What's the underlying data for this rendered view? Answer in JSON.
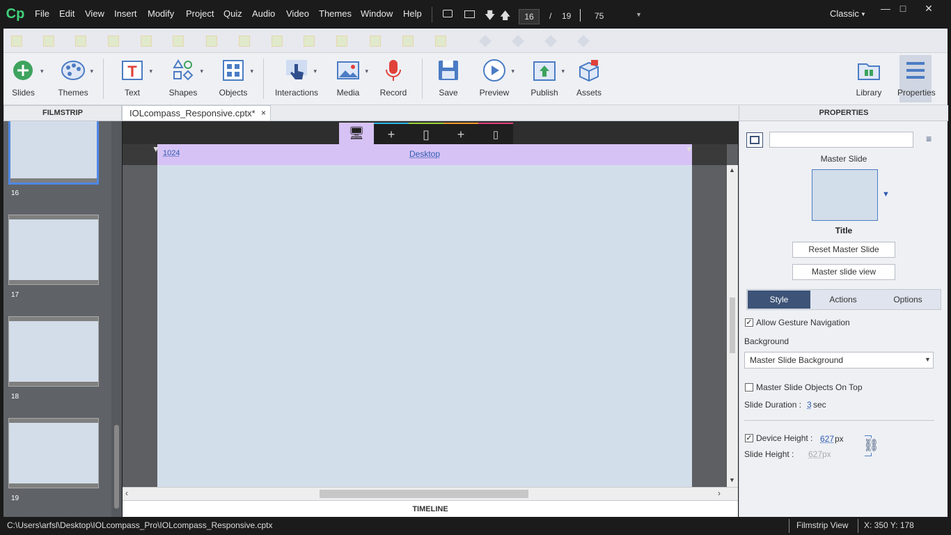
{
  "app": {
    "logo": "Cp",
    "mode": "Classic",
    "zoom": "75"
  },
  "menu": [
    "File",
    "Edit",
    "View",
    "Insert",
    "Modify",
    "Project",
    "Quiz",
    "Audio",
    "Video",
    "Themes",
    "Window",
    "Help"
  ],
  "nav": {
    "current_slide": "16",
    "separator": "/",
    "total_slides": "19"
  },
  "window_controls": {
    "minimize": "—",
    "maximize": "□",
    "close": "✕"
  },
  "toolbar": {
    "slides": "Slides",
    "themes": "Themes",
    "text": "Text",
    "shapes": "Shapes",
    "objects": "Objects",
    "interactions": "Interactions",
    "media": "Media",
    "record": "Record",
    "save": "Save",
    "preview": "Preview",
    "publish": "Publish",
    "assets": "Assets",
    "library": "Library",
    "properties": "Properties"
  },
  "filmstrip": {
    "title": "FILMSTRIP",
    "slides": [
      "16",
      "17",
      "18",
      "19"
    ]
  },
  "document": {
    "tab_label": "IOLcompass_Responsive.cptx*",
    "close": "×"
  },
  "canvas": {
    "ruler_width": "1024",
    "breakpoint": "Desktop",
    "timeline": "TIMELINE"
  },
  "properties": {
    "title": "PROPERTIES",
    "name_value": "",
    "master_slide_label": "Master Slide",
    "master_name": "Title",
    "reset_button": "Reset Master Slide",
    "master_view_button": "Master slide view",
    "tabs": [
      "Style",
      "Actions",
      "Options"
    ],
    "allow_gesture": "Allow Gesture Navigation",
    "background_label": "Background",
    "background_value": "Master Slide Background",
    "master_on_top": "Master Slide Objects On Top",
    "duration_label": "Slide Duration :",
    "duration_value": "3",
    "duration_unit": "sec",
    "device_height_label": "Device Height :",
    "device_height_value": "627",
    "slide_height_label": "Slide Height :",
    "slide_height_value": "627",
    "px": "px"
  },
  "status": {
    "path": "C:\\Users\\arfsl\\Desktop\\IOLcompass_Pro\\IOLcompass_Responsive.cptx",
    "view": "Filmstrip View",
    "coords": "X: 350 Y: 178"
  },
  "colors": {
    "accent": "#3d5377",
    "breakpoint_bg": "#d7c2f5",
    "slide_bg": "#d3deeb",
    "logo": "#3fd07a"
  }
}
